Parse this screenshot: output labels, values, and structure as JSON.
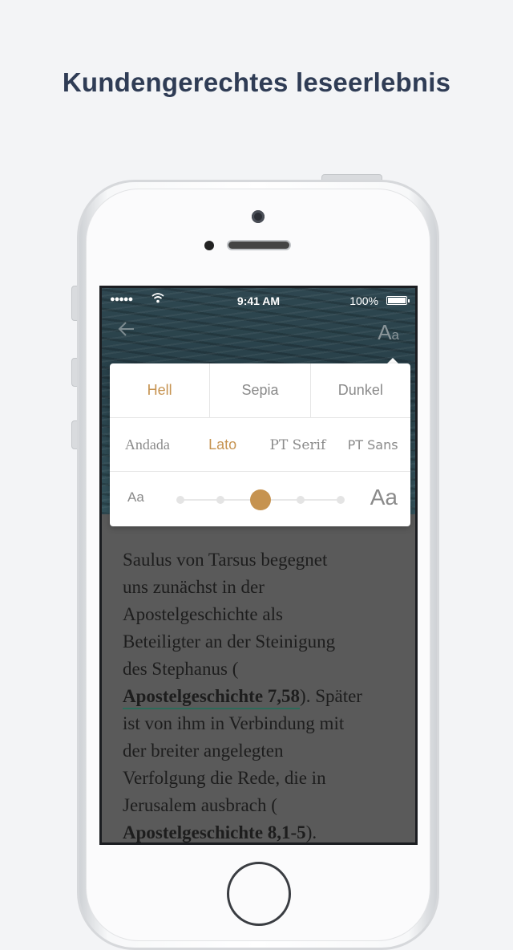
{
  "headline": "Kundengerechtes leseerlebnis",
  "status_bar": {
    "signal": "●●●●●",
    "time": "9:41 AM",
    "battery_percent": "100%",
    "battery_level": 1.0
  },
  "toolbar": {
    "back_icon": "arrow-left-icon",
    "font_settings_big": "A",
    "font_settings_small": "a"
  },
  "settings": {
    "themes": [
      {
        "label": "Hell",
        "active": true
      },
      {
        "label": "Sepia",
        "active": false
      },
      {
        "label": "Dunkel",
        "active": false
      }
    ],
    "fonts": [
      {
        "label": "Andada",
        "active": false
      },
      {
        "label": "Lato",
        "active": true
      },
      {
        "label": "PT Serif",
        "active": false
      },
      {
        "label": "PT Sans",
        "active": false
      }
    ],
    "size_small_label": "Aa",
    "size_large_label": "Aa",
    "size_steps": 5,
    "size_selected_index": 2,
    "accent_color": "#c69350"
  },
  "content": {
    "line1": "Saulus von Tarsus begegnet",
    "line2": "uns zunächst in der",
    "line3": "Apostelgeschichte als",
    "line4": "Beteiligter an der Steinigung",
    "line5": "des Stephanus (",
    "ref1": "Apostelgeschichte 7,58",
    "line6_rest": "). Später",
    "line7": "ist von ihm in Verbindung mit",
    "line8": "der breiter angelegten",
    "line9": "Verfolgung die Rede, die in",
    "line10": "Jerusalem ausbrach (",
    "ref2": "Apostelgeschichte 8,1-5",
    "line11_rest": ")."
  }
}
